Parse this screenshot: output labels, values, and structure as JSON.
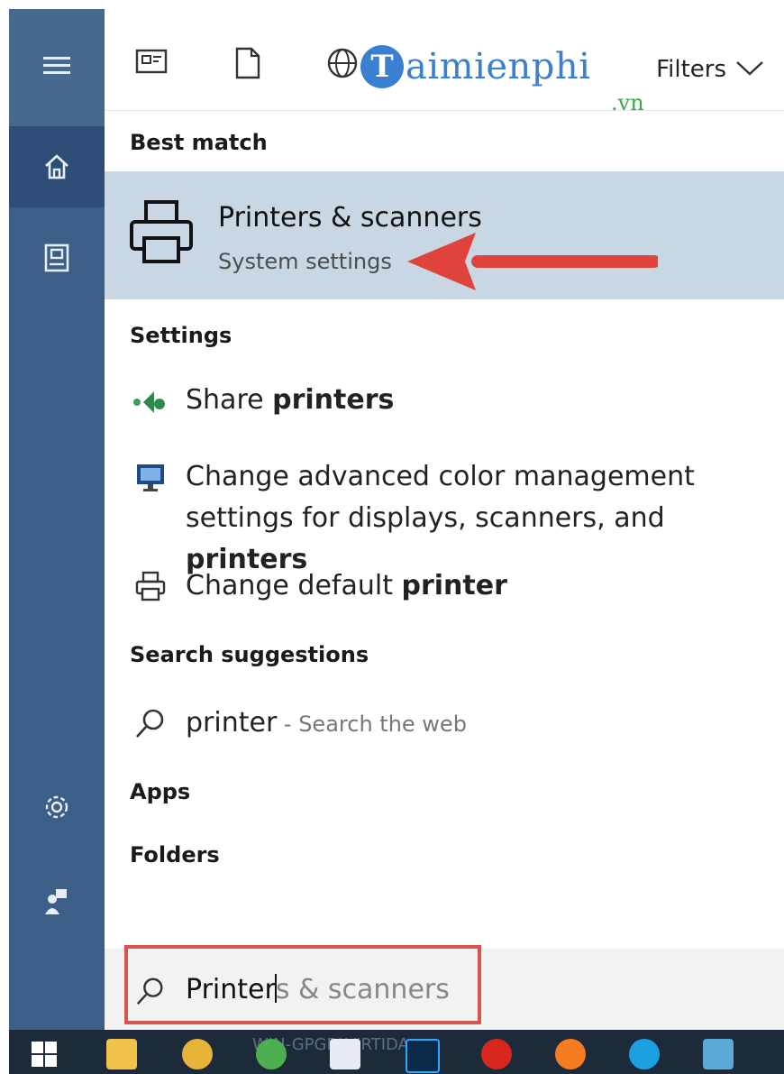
{
  "rail": {
    "items": [
      {
        "name": "menu",
        "icon": "hamburger-menu-icon"
      },
      {
        "name": "home",
        "icon": "home-icon"
      },
      {
        "name": "documents",
        "icon": "document-icon"
      },
      {
        "name": "settings",
        "icon": "gear-icon"
      },
      {
        "name": "user",
        "icon": "user-icon"
      }
    ]
  },
  "topbar": {
    "filter_icons": [
      "apps-filter-icon",
      "documents-filter-icon",
      "web-filter-icon"
    ],
    "filters_label": "Filters"
  },
  "watermark": {
    "logo_letter": "T",
    "brand": "aimienphi",
    "tld": ".vn"
  },
  "best_match": {
    "header": "Best match",
    "title_prefix": "Printer",
    "title_suffix": "s & scanners",
    "subtitle": "System settings"
  },
  "settings": {
    "header": "Settings",
    "items": [
      {
        "icon": "share-icon",
        "text": "Share ",
        "bold": "printers"
      },
      {
        "icon": "monitor-icon",
        "line1": "Change advanced color management",
        "line2": "settings for displays, scanners, and ",
        "bold": "printers"
      },
      {
        "icon": "printer-icon",
        "text": "Change default ",
        "bold": "printer"
      }
    ]
  },
  "search_suggestions": {
    "header": "Search suggestions",
    "query": "printer",
    "hint": " - Search the web"
  },
  "apps_header": "Apps",
  "folders_header": "Folders",
  "search": {
    "typed": "Printer",
    "autocomplete": "s & scanners"
  },
  "taskbar": {
    "label": "WIN-GPGBLVIRTIDA",
    "apps": [
      "windows-start",
      "file-explorer",
      "photos",
      "chrome",
      "mail",
      "photoshop",
      "opera",
      "firefox",
      "skype",
      "control-panel"
    ]
  },
  "colors": {
    "rail": "#3d5e87",
    "best_match_bg": "#c9d6e4",
    "annotation_red": "#e0433c",
    "watermark_blue": "#3b7fd1"
  }
}
